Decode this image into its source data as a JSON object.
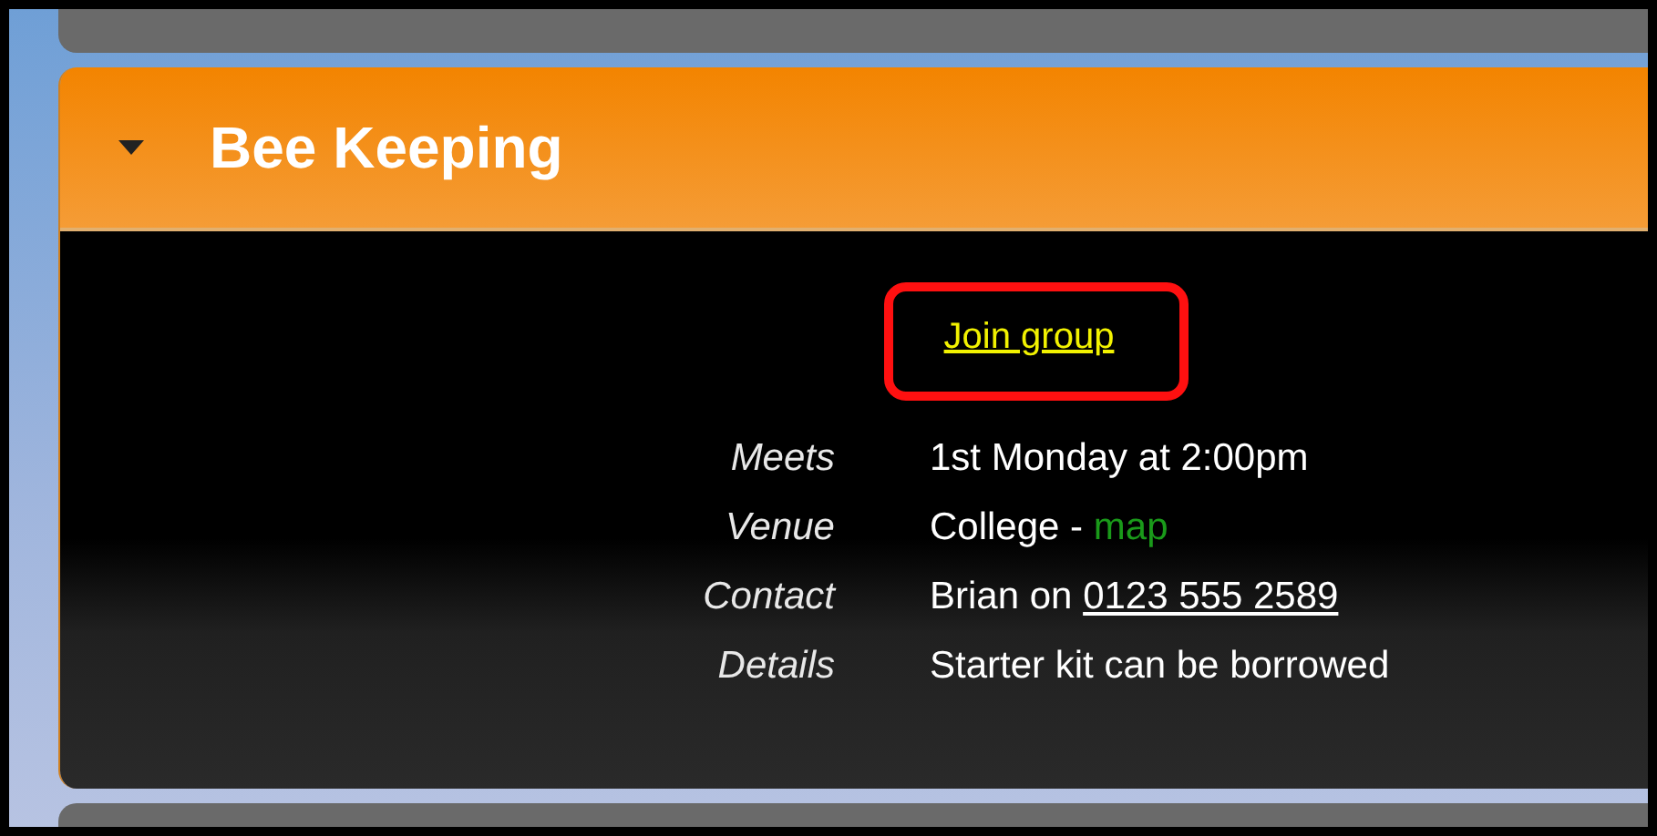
{
  "section": {
    "title": "Bee Keeping",
    "expanded": true
  },
  "join_link": {
    "label": "Join group",
    "highlighted": true
  },
  "details": [
    {
      "label": "Meets",
      "parts": [
        {
          "kind": "text",
          "text": "1st Monday at 2:00pm"
        }
      ]
    },
    {
      "label": "Venue",
      "parts": [
        {
          "kind": "text",
          "text": "College - "
        },
        {
          "kind": "map_link",
          "text": "map"
        }
      ]
    },
    {
      "label": "Contact",
      "parts": [
        {
          "kind": "text",
          "text": "Brian on "
        },
        {
          "kind": "phone_link",
          "text": "0123 555 2589"
        }
      ]
    },
    {
      "label": "Details",
      "parts": [
        {
          "kind": "text",
          "text": "Starter kit can be borrowed"
        }
      ]
    }
  ]
}
